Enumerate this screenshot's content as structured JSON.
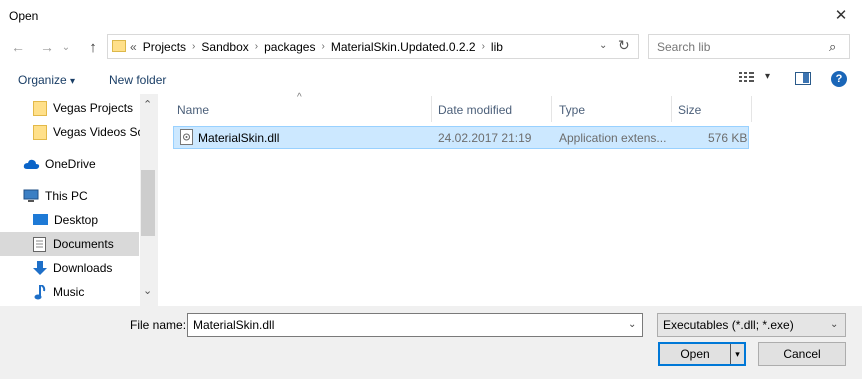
{
  "window": {
    "title": "Open",
    "close_glyph": "✕"
  },
  "nav": {
    "back_glyph": "←",
    "forward_glyph": "→",
    "recent_glyph": "⌄",
    "up_glyph": "↑",
    "breadcrumb_overflow": "«",
    "breadcrumbs": [
      "Projects",
      "Sandbox",
      "packages",
      "MaterialSkin.Updated.0.2.2",
      "lib"
    ],
    "crumb_sep": "›",
    "address_drop_glyph": "⌄",
    "refresh_glyph": "↻"
  },
  "search": {
    "placeholder": "Search lib",
    "icon_glyph": "⌕"
  },
  "toolbar": {
    "organize_label": "Organize",
    "organize_arrow": "▾",
    "new_folder_label": "New folder",
    "view_arrow": "▾",
    "help_glyph": "?"
  },
  "sidebar": {
    "scroll_up": "⌃",
    "scroll_down": "⌄",
    "items": [
      {
        "label": "Vegas Projects",
        "icon": "folder-icon"
      },
      {
        "label": "Vegas Videos Sor",
        "icon": "folder-icon"
      },
      {
        "label": "OneDrive",
        "icon": "cloud-icon"
      },
      {
        "label": "This PC",
        "icon": "computer-icon"
      },
      {
        "label": "Desktop",
        "icon": "desktop-icon"
      },
      {
        "label": "Documents",
        "icon": "documents-icon",
        "selected": true
      },
      {
        "label": "Downloads",
        "icon": "download-icon"
      },
      {
        "label": "Music",
        "icon": "music-icon"
      }
    ]
  },
  "file_list": {
    "sort_glyph": "^",
    "columns": {
      "name": "Name",
      "date": "Date modified",
      "type": "Type",
      "size": "Size"
    },
    "rows": [
      {
        "name": "MaterialSkin.dll",
        "date": "24.02.2017 21:19",
        "type": "Application extens...",
        "size": "576 KB",
        "selected": true
      }
    ]
  },
  "bottom": {
    "file_name_label": "File name:",
    "file_name_value": "MaterialSkin.dll",
    "filter_value": "Executables (*.dll; *.exe)",
    "dropdown_glyph": "⌄",
    "open_label": "Open",
    "open_split_glyph": "▾",
    "cancel_label": "Cancel"
  },
  "colors": {
    "accent": "#0078d7",
    "selection": "#cce8ff",
    "selection_border": "#99d1ff"
  }
}
